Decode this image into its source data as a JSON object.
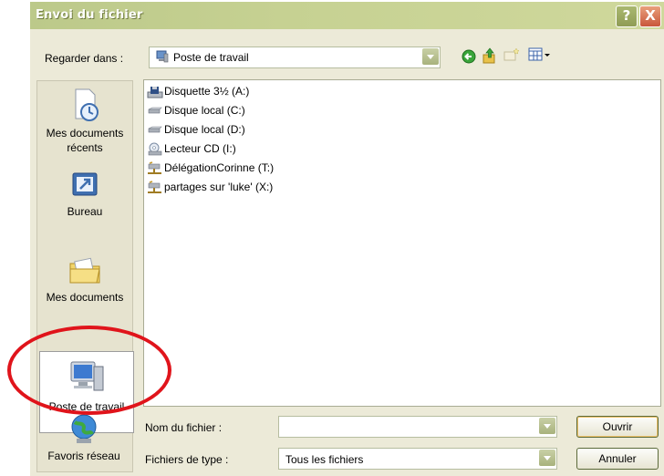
{
  "window": {
    "title": "Envoi du fichier",
    "help_label": "?",
    "close_label": "X"
  },
  "look_in": {
    "label": "Regarder dans :",
    "value": "Poste de travail"
  },
  "toolbar": {
    "icons": [
      "back-arrow-icon",
      "up-folder-icon",
      "new-folder-icon",
      "views-menu-icon"
    ]
  },
  "places": [
    {
      "label": "Mes documents récents",
      "icon": "recent-documents-icon"
    },
    {
      "label": "Bureau",
      "icon": "desktop-icon"
    },
    {
      "label": "Mes documents",
      "icon": "my-documents-icon"
    },
    {
      "label": "Poste de travail",
      "icon": "my-computer-icon"
    },
    {
      "label": "Favoris réseau",
      "icon": "network-places-icon"
    }
  ],
  "files": [
    {
      "name": "Disquette 3½ (A:)",
      "icon": "floppy-drive-icon"
    },
    {
      "name": "Disque local (C:)",
      "icon": "hard-drive-icon"
    },
    {
      "name": "Disque local (D:)",
      "icon": "hard-drive-icon"
    },
    {
      "name": "Lecteur CD (I:)",
      "icon": "cd-drive-icon"
    },
    {
      "name": "DélégationCorinne (T:)",
      "icon": "network-drive-icon"
    },
    {
      "name": "partages sur 'luke' (X:)",
      "icon": "network-drive-icon"
    }
  ],
  "file_name": {
    "label": "Nom du fichier :",
    "value": ""
  },
  "file_type": {
    "label": "Fichiers de type :",
    "value": "Tous les fichiers"
  },
  "buttons": {
    "open": "Ouvrir",
    "cancel": "Annuler"
  },
  "colors": {
    "titlebar": "#c6d192",
    "client_bg": "#ecead8",
    "highlight_circle": "#e0141b"
  }
}
